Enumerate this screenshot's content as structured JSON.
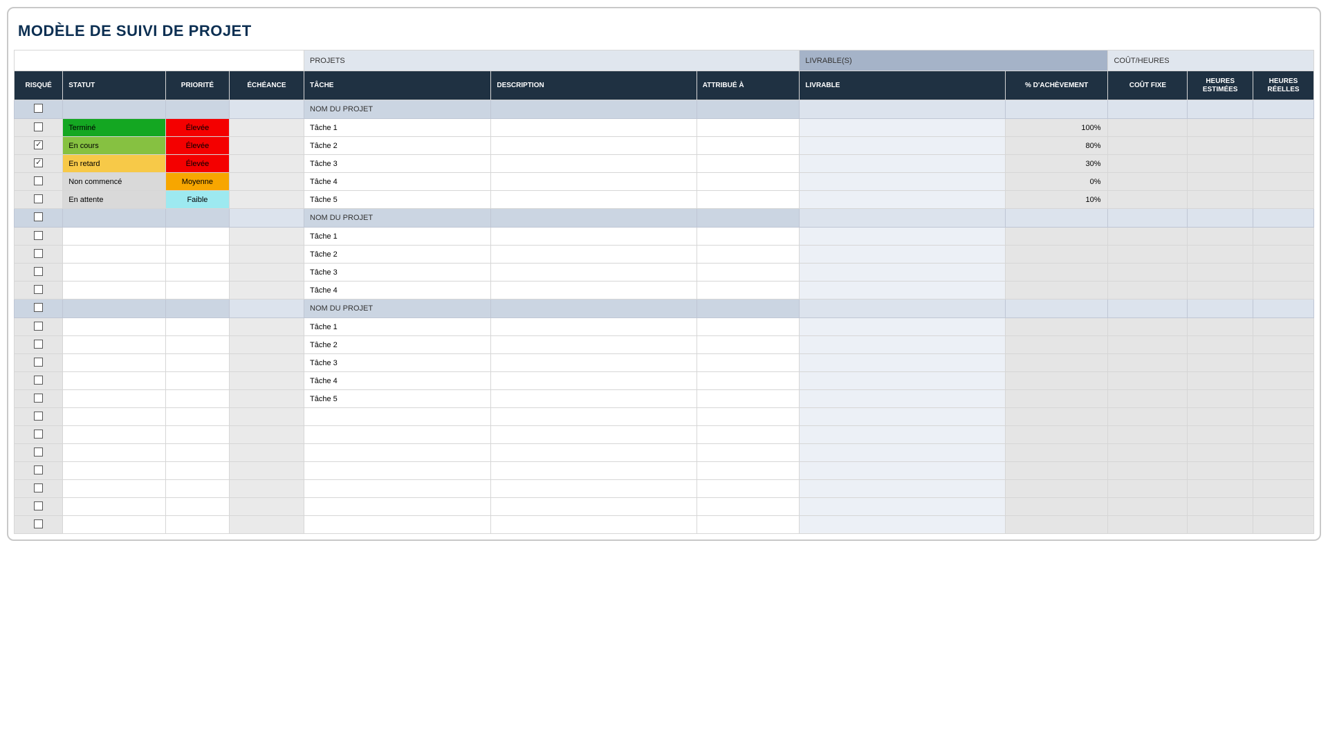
{
  "title": "MODÈLE DE SUIVI DE PROJET",
  "groupHeaders": {
    "projets": "PROJETS",
    "livrables": "LIVRABLE(S)",
    "cout": "COÛT/HEURES"
  },
  "columns": {
    "risque": "RISQUÉ",
    "statut": "STATUT",
    "priorite": "PRIORITÉ",
    "echeance": "ÉCHÉANCE",
    "tache": "TÂCHE",
    "description": "DESCRIPTION",
    "attribue": "ATTRIBUÉ À",
    "livrable": "LIVRABLE",
    "pct": "% D'ACHÈVEMENT",
    "cout": "COÛT FIXE",
    "heuresEst": "HEURES ESTIMÉES",
    "heuresReelles": "HEURES RÉELLES"
  },
  "projectHeaderLabel": "NOM DU PROJET",
  "status": {
    "termine": "Terminé",
    "encours": "En cours",
    "enretard": "En retard",
    "noncommence": "Non commencé",
    "enattente": "En attente"
  },
  "priority": {
    "elevee": "Élevée",
    "moyenne": "Moyenne",
    "faible": "Faible"
  },
  "projects": [
    {
      "tasks": [
        {
          "risk": false,
          "statut": "termine",
          "priorite": "elevee",
          "tache": "Tâche 1",
          "pct": "100%"
        },
        {
          "risk": true,
          "statut": "encours",
          "priorite": "elevee",
          "tache": "Tâche 2",
          "pct": "80%"
        },
        {
          "risk": true,
          "statut": "enretard",
          "priorite": "elevee",
          "tache": "Tâche 3",
          "pct": "30%"
        },
        {
          "risk": false,
          "statut": "noncommence",
          "priorite": "moyenne",
          "tache": "Tâche 4",
          "pct": "0%"
        },
        {
          "risk": false,
          "statut": "enattente",
          "priorite": "faible",
          "tache": "Tâche 5",
          "pct": "10%"
        }
      ]
    },
    {
      "tasks": [
        {
          "risk": false,
          "tache": "Tâche 1"
        },
        {
          "risk": false,
          "tache": "Tâche 2"
        },
        {
          "risk": false,
          "tache": "Tâche 3"
        },
        {
          "risk": false,
          "tache": "Tâche 4"
        }
      ]
    },
    {
      "tasks": [
        {
          "risk": false,
          "tache": "Tâche 1"
        },
        {
          "risk": false,
          "tache": "Tâche 2"
        },
        {
          "risk": false,
          "tache": "Tâche 3"
        },
        {
          "risk": false,
          "tache": "Tâche 4"
        },
        {
          "risk": false,
          "tache": "Tâche 5"
        }
      ]
    }
  ],
  "emptyRowsAfter": 7
}
